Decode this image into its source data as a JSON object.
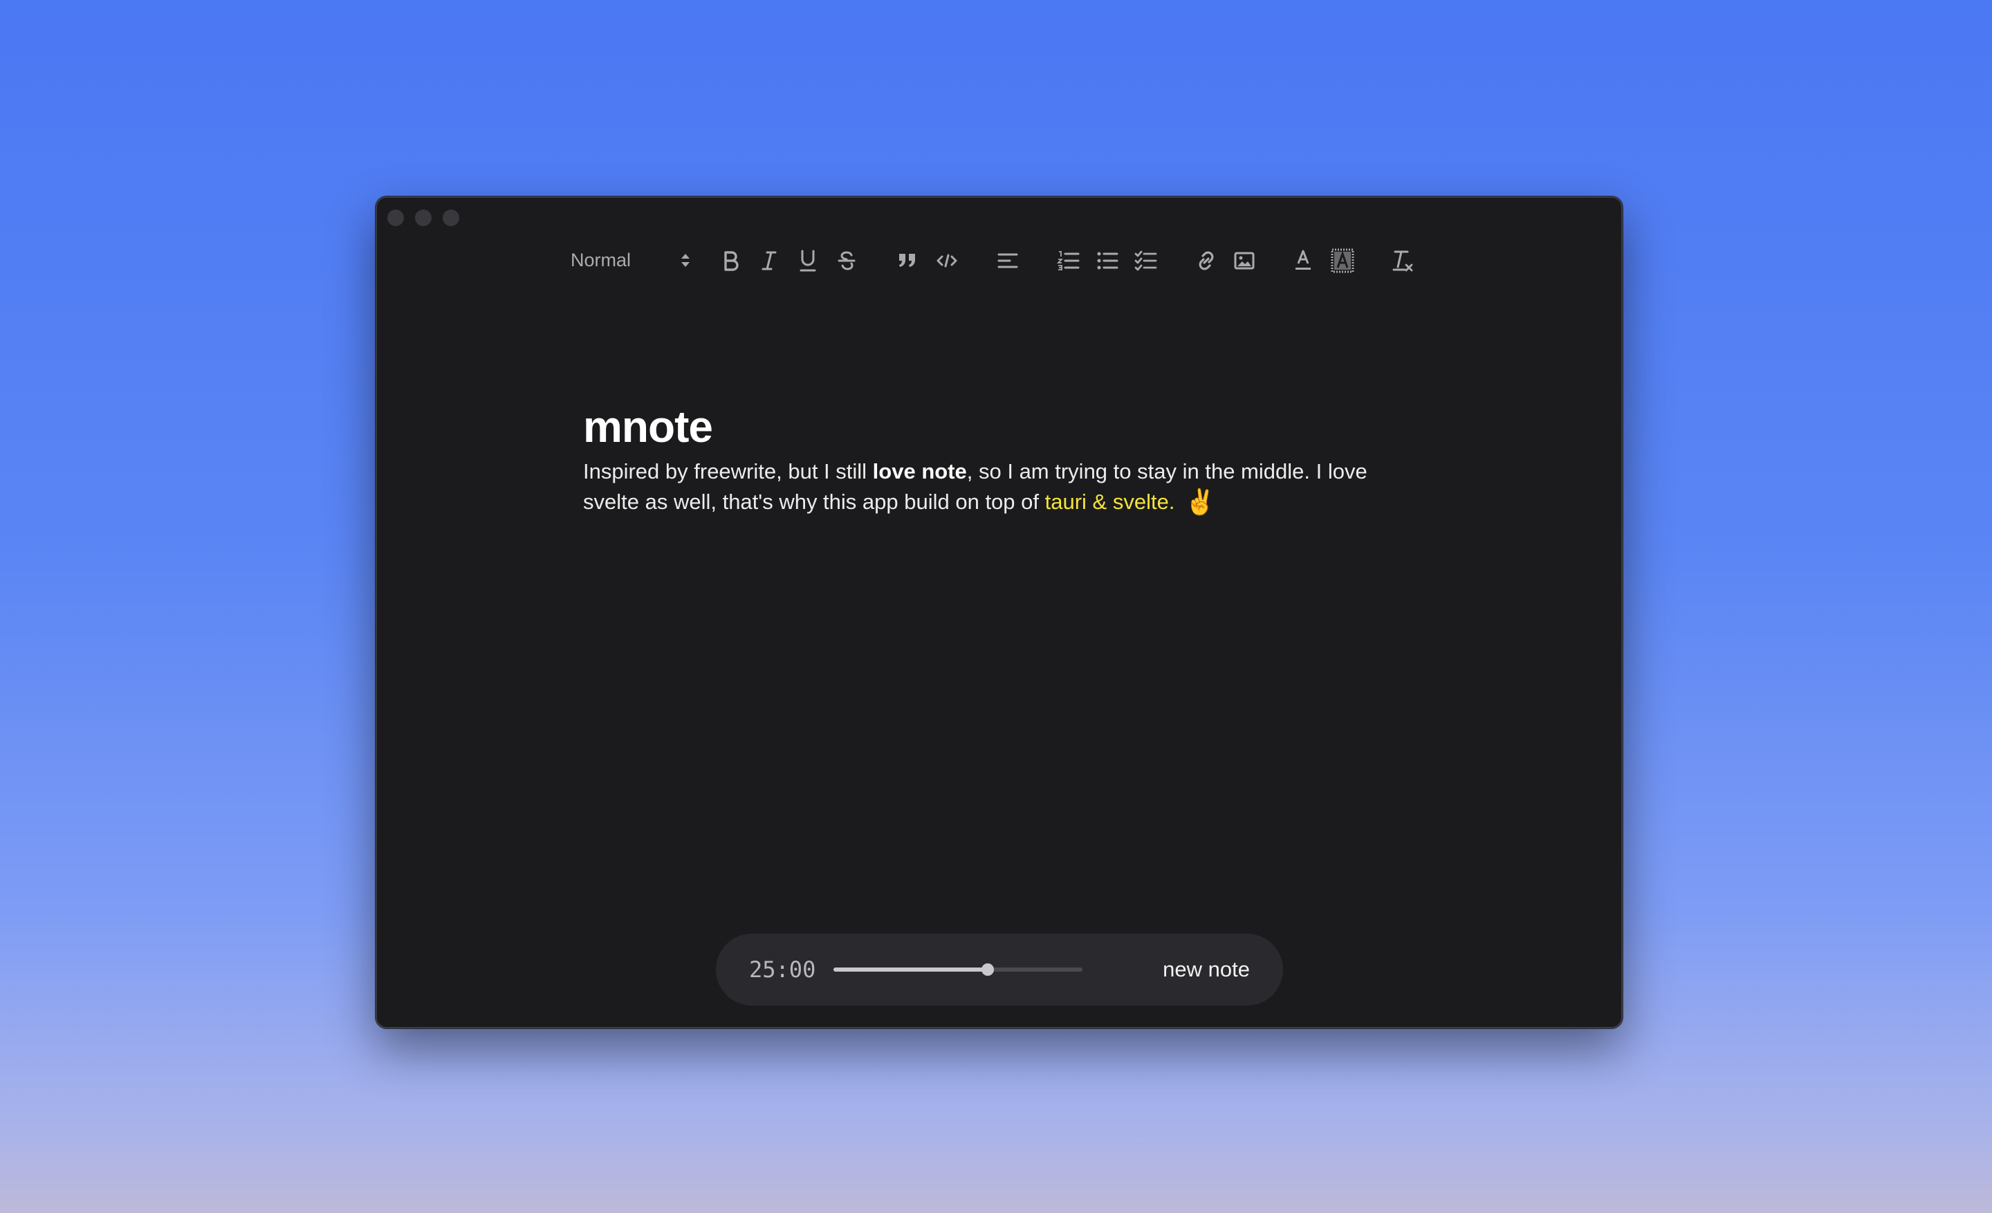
{
  "toolbar": {
    "format_select": {
      "value": "Normal"
    },
    "buttons": [
      {
        "name": "bold-button",
        "icon": "bold-icon"
      },
      {
        "name": "italic-button",
        "icon": "italic-icon"
      },
      {
        "name": "underline-button",
        "icon": "underline-icon"
      },
      {
        "name": "strike-button",
        "icon": "strikethrough-icon"
      },
      {
        "name": "blockquote-button",
        "icon": "quote-icon"
      },
      {
        "name": "code-block-button",
        "icon": "code-icon"
      },
      {
        "name": "align-button",
        "icon": "align-left-icon"
      },
      {
        "name": "ordered-list-button",
        "icon": "ordered-list-icon"
      },
      {
        "name": "bullet-list-button",
        "icon": "bullet-list-icon"
      },
      {
        "name": "check-list-button",
        "icon": "checklist-icon"
      },
      {
        "name": "link-button",
        "icon": "link-icon"
      },
      {
        "name": "image-button",
        "icon": "image-icon"
      },
      {
        "name": "text-color-button",
        "icon": "text-color-icon"
      },
      {
        "name": "background-color-button",
        "icon": "background-color-icon"
      },
      {
        "name": "clear-format-button",
        "icon": "clear-format-icon"
      }
    ]
  },
  "editor": {
    "title": "mnote",
    "paragraph": {
      "part1": "Inspired by freewrite, but I still ",
      "bold": "love note",
      "part2": ", so I am trying to stay in the middle. I love svelte as well, that's why this app build on top of ",
      "highlight": "tauri & svelte",
      "part3": ".",
      "emoji": "✌️"
    }
  },
  "footer": {
    "timer": "25:00",
    "slider_progress": 0.62,
    "new_note_label": "new note"
  },
  "colors": {
    "highlight": "#f5e33c",
    "window_bg": "#1b1b1d",
    "bar_bg": "#2a2a2e"
  }
}
